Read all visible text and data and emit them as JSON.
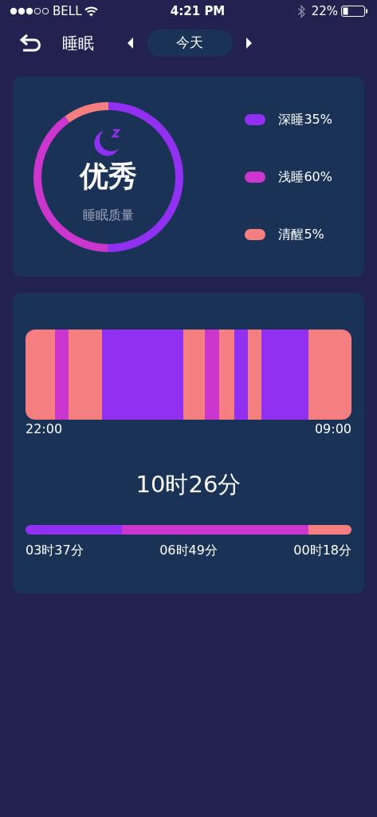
{
  "status_bar": {
    "carrier": "BELL",
    "time": "4:21 PM",
    "battery": "22%"
  },
  "nav": {
    "title": "睡眠",
    "date": "今天"
  },
  "quality": {
    "rating": "优秀",
    "label": "睡眠质量"
  },
  "legend": [
    {
      "kind": "deep",
      "label": "深睡35%",
      "color": "#9130f0"
    },
    {
      "kind": "light",
      "label": "浅睡60%",
      "color": "#cd35cf"
    },
    {
      "kind": "awake",
      "label": "清醒5%",
      "color": "#f57e80"
    }
  ],
  "timeline": {
    "start": "22:00",
    "end": "09:00",
    "segments": [
      {
        "kind": "awake"
      },
      {
        "kind": "light"
      },
      {
        "kind": "awake"
      },
      {
        "kind": "deep"
      },
      {
        "kind": "awake"
      },
      {
        "kind": "light"
      },
      {
        "kind": "awake"
      },
      {
        "kind": "deep"
      },
      {
        "kind": "awake"
      },
      {
        "kind": "deep"
      },
      {
        "kind": "awake"
      }
    ]
  },
  "summary": {
    "total": "10时26分",
    "breakdown": [
      {
        "kind": "deep",
        "label": "03时37分"
      },
      {
        "kind": "light",
        "label": "06时49分"
      },
      {
        "kind": "awake",
        "label": "00时18分"
      }
    ]
  }
}
